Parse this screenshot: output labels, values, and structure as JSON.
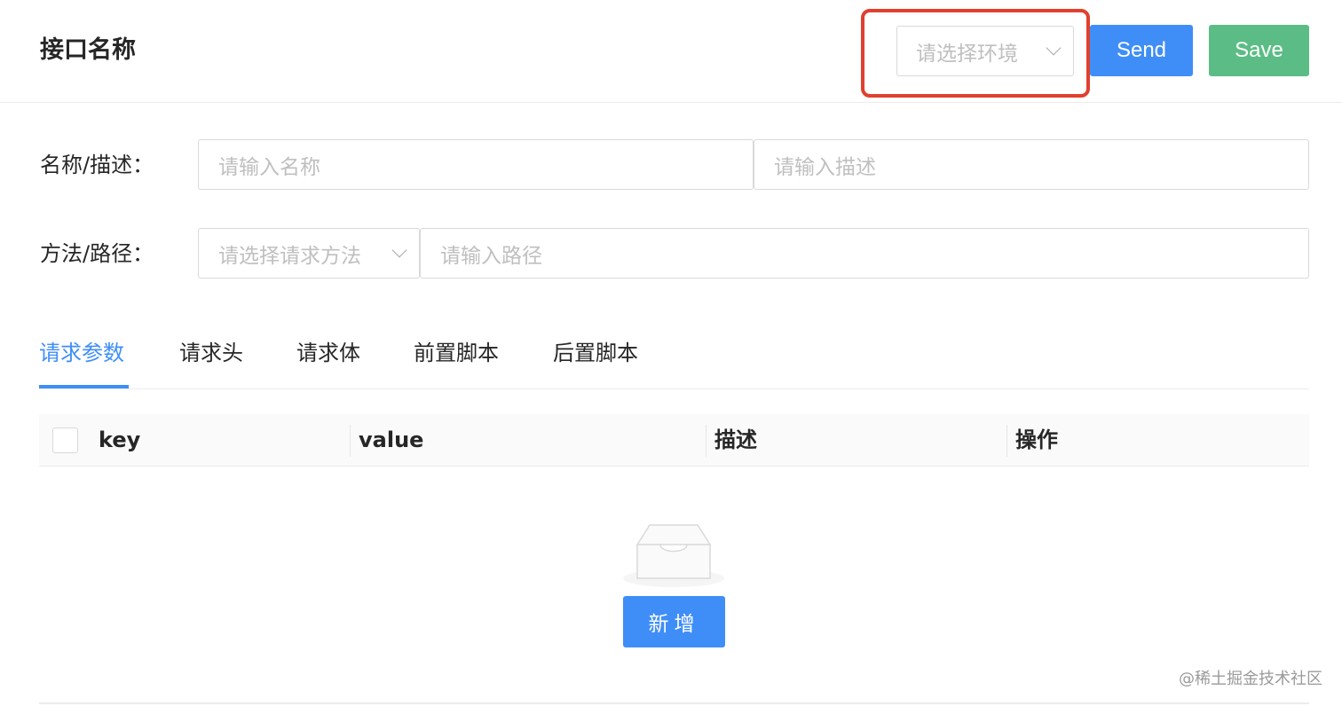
{
  "header": {
    "title": "接口名称",
    "env_select_placeholder": "请选择环境",
    "send_label": "Send",
    "save_label": "Save"
  },
  "form": {
    "name_label": "名称/描述：",
    "name_placeholder": "请输入名称",
    "desc_placeholder": "请输入描述",
    "path_label": "方法/路径：",
    "method_placeholder": "请选择请求方法",
    "path_placeholder": "请输入路径"
  },
  "tabs": [
    {
      "label": "请求参数",
      "active": true
    },
    {
      "label": "请求头",
      "active": false
    },
    {
      "label": "请求体",
      "active": false
    },
    {
      "label": "前置脚本",
      "active": false
    },
    {
      "label": "后置脚本",
      "active": false
    }
  ],
  "table": {
    "columns": [
      "key",
      "value",
      "描述",
      "操作"
    ],
    "rows": []
  },
  "empty_state": {
    "add_label": "新增"
  },
  "watermark": "@稀土掘金技术社区",
  "colors": {
    "primary": "#3f8ef7",
    "success": "#5bbd85",
    "highlight": "#e0402e"
  }
}
